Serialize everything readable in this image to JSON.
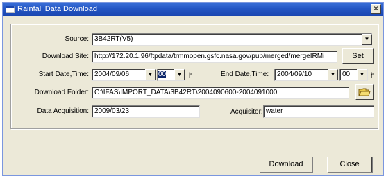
{
  "window": {
    "title": "Rainfall Data Download",
    "close_glyph": "×"
  },
  "source": {
    "label": "Source:",
    "value": "3B42RT(V5)"
  },
  "download_site": {
    "label": "Download Site:",
    "value": "http://172.20.1.96/ftpdata/trmmopen.gsfc.nasa.gov/pub/merged/mergeIRMi",
    "button": "Set"
  },
  "start": {
    "label": "Start Date,Time:",
    "date": "2004/09/06",
    "hour": "00",
    "unit": "h"
  },
  "end": {
    "label": "End Date,Time:",
    "date": "2004/09/10",
    "hour": "00",
    "unit": "h"
  },
  "download_folder": {
    "label": "Download Folder:",
    "value": "C:\\IFAS\\IMPORT_DATA\\3B42RT\\2004090600-2004091000"
  },
  "acquisition": {
    "label": "Data Acquisition:",
    "value": "2009/03/23"
  },
  "acquisitor": {
    "label": "Acquisitor:",
    "value": "water"
  },
  "buttons": {
    "download": "Download",
    "close": "Close"
  },
  "icons": {
    "window": "app-window-icon",
    "dropdown": "chevron-down-icon",
    "folder": "open-folder-icon"
  }
}
